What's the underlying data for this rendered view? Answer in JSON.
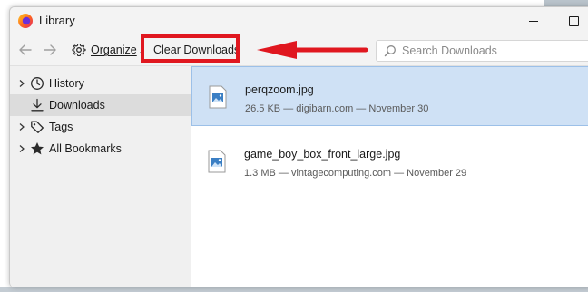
{
  "window": {
    "title": "Library",
    "app_icon": "firefox-icon"
  },
  "toolbar": {
    "back_icon": "arrow-left-icon",
    "forward_icon": "arrow-right-icon",
    "organize_icon": "gear-icon",
    "organize_label": "Organize",
    "clear_downloads_label": "Clear Downloads",
    "search_placeholder": "Search Downloads",
    "search_value": ""
  },
  "annotation": {
    "highlight_color": "#e0171f",
    "arrow_color": "#e0171f"
  },
  "sidebar": {
    "items": [
      {
        "label": "History",
        "icon": "clock-icon",
        "expandable": true,
        "selected": false
      },
      {
        "label": "Downloads",
        "icon": "download-icon",
        "expandable": false,
        "selected": true
      },
      {
        "label": "Tags",
        "icon": "tag-icon",
        "expandable": true,
        "selected": false
      },
      {
        "label": "All Bookmarks",
        "icon": "star-icon",
        "expandable": true,
        "selected": false
      }
    ]
  },
  "downloads": [
    {
      "name": "perqzoom.jpg",
      "meta": "26.5 KB — digibarn.com — November 30",
      "icon": "image-file-icon",
      "selected": true
    },
    {
      "name": "game_boy_box_front_large.jpg",
      "meta": "1.3 MB — vintagecomputing.com — November 29",
      "icon": "image-file-icon",
      "selected": false
    }
  ],
  "colors": {
    "selection_bg": "#cfe1f5",
    "selection_border": "#9cc0e8",
    "sidebar_selected_bg": "#dcdcdc"
  }
}
